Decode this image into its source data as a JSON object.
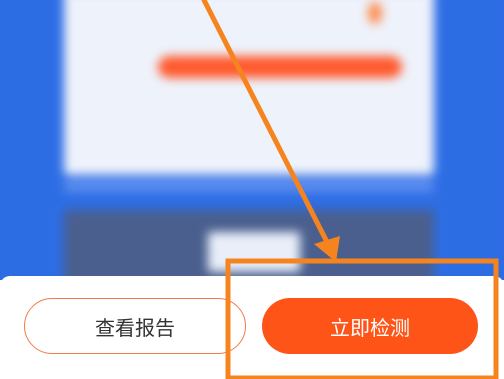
{
  "actions": {
    "view_report_label": "查看报告",
    "detect_now_label": "立即检测"
  },
  "colors": {
    "accent": "#ff5418",
    "annotation": "#f5841f",
    "background_blue": "#2d6de4"
  }
}
